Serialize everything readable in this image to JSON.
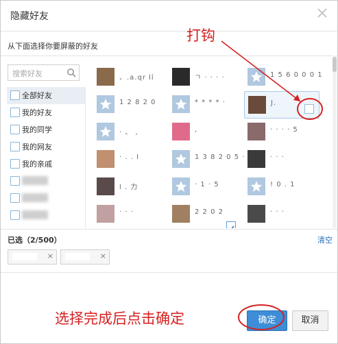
{
  "dialog": {
    "title": "隐藏好友",
    "subtitle": "从下面选择你要屏蔽的好友",
    "close_icon": "close-icon"
  },
  "search": {
    "placeholder": "搜索好友",
    "icon": "search-icon"
  },
  "groups": [
    {
      "label": "全部好友",
      "selected": true
    },
    {
      "label": "我的好友",
      "selected": false
    },
    {
      "label": "我的同学",
      "selected": false
    },
    {
      "label": "我的网友",
      "selected": false
    },
    {
      "label": "我的亲戚",
      "selected": false
    },
    {
      "label": "",
      "selected": false
    },
    {
      "label": "",
      "selected": false
    },
    {
      "label": "",
      "selected": false
    }
  ],
  "friends": [
    {
      "name": "、.a.qr lỉ",
      "avatar_color": "#8a6a4a"
    },
    {
      "name": "ㄱ · · · ·",
      "avatar_color": "#2a2a2a"
    },
    {
      "name": "1 5 6 0 0 0 1",
      "avatar_color": "#b0c8e0"
    },
    {
      "name": "1 2 8 2 0",
      "avatar_color": "#b0c8e0"
    },
    {
      "name": "* * * * ·",
      "avatar_color": "#b0c8e0"
    },
    {
      "name": "J.",
      "avatar_color": "#6a4a3a"
    },
    {
      "name": "· 、 ,",
      "avatar_color": "#b0c8e0"
    },
    {
      "name": ",",
      "avatar_color": "#e06a8a"
    },
    {
      "name": "· · · · 5",
      "avatar_color": "#8a6a6a"
    },
    {
      "name": "· . . I",
      "avatar_color": "#c09070"
    },
    {
      "name": "1 3 8 2 0 5 ·",
      "avatar_color": "#b0c8e0"
    },
    {
      "name": "· · ·",
      "avatar_color": "#3a3a3a"
    },
    {
      "name": "l . 力",
      "avatar_color": "#5a4a4a"
    },
    {
      "name": "· 1 · 5",
      "avatar_color": "#b0c8e0"
    },
    {
      "name": "! 0 . 1",
      "avatar_color": "#b0c8e0"
    },
    {
      "name": "· · ·",
      "avatar_color": "#c0a0a0"
    },
    {
      "name": "2 2 0 2",
      "avatar_color": "#a08060"
    },
    {
      "name": "· · ·",
      "avatar_color": "#4a4a4a"
    }
  ],
  "selection": {
    "label": "已选（2/500）",
    "clear_label": "清空"
  },
  "tags": [
    {
      "remove": "×"
    },
    {
      "remove": "×"
    }
  ],
  "buttons": {
    "ok": "确定",
    "cancel": "取消"
  },
  "annotations": {
    "check_hint": "打钩",
    "confirm_hint": "选择完成后点击确定"
  }
}
